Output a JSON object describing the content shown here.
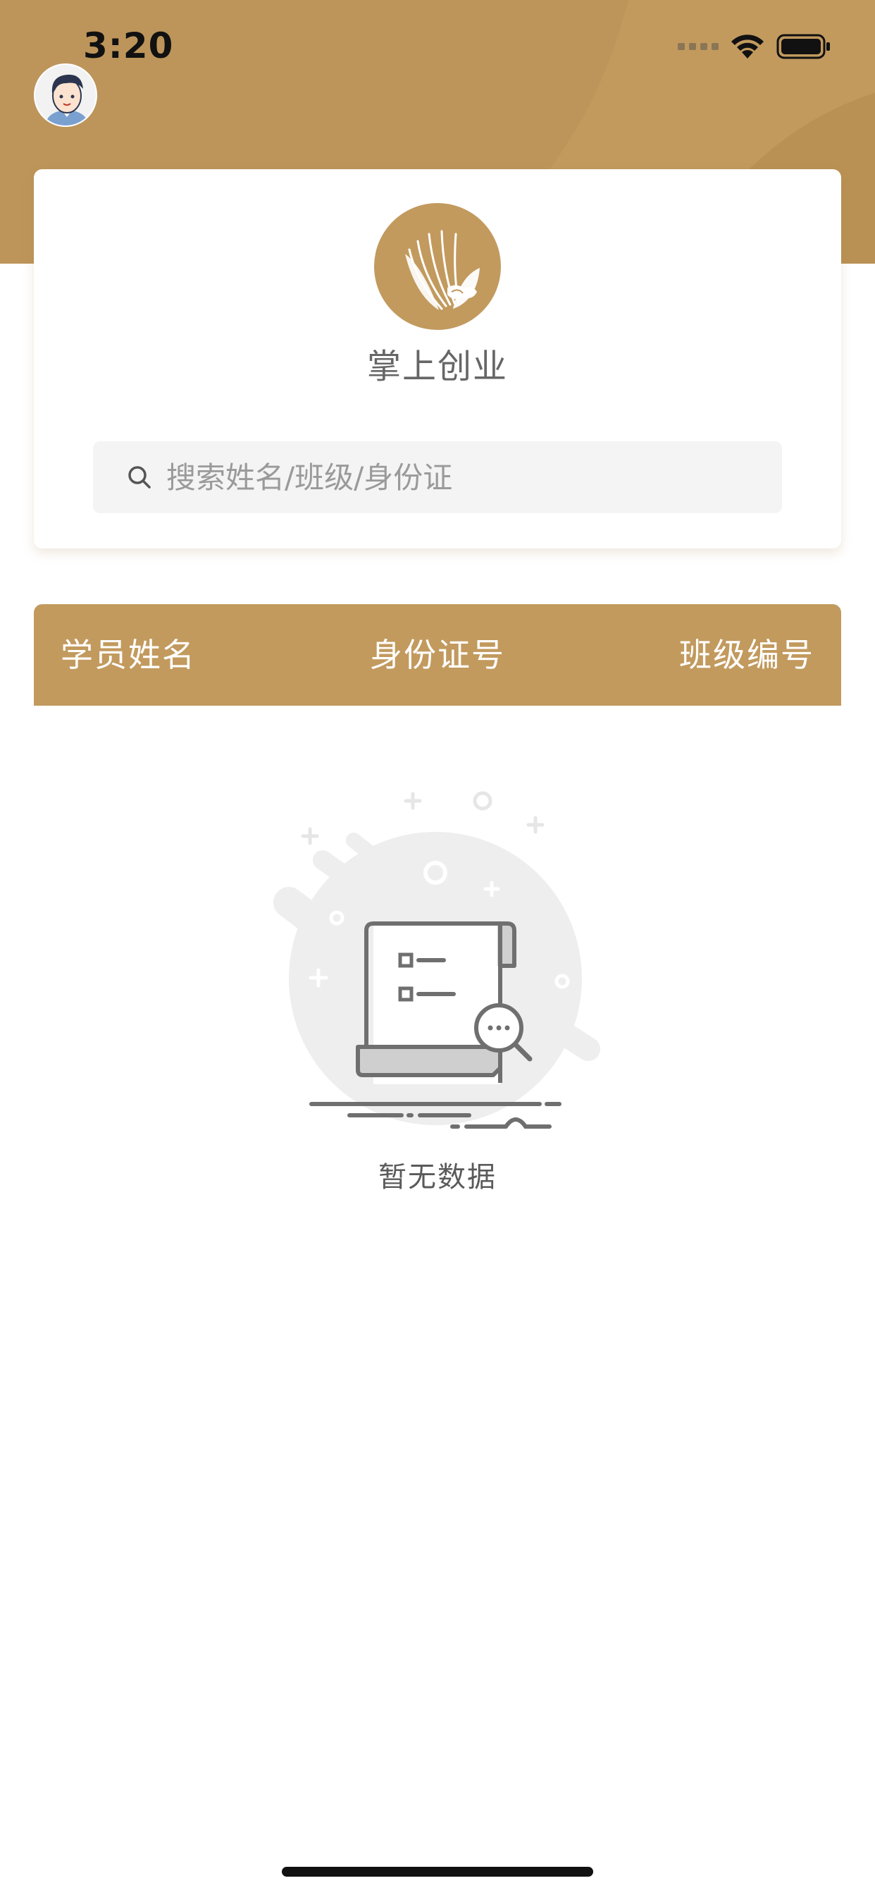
{
  "status_bar": {
    "time": "3:20"
  },
  "brand": {
    "name": "掌上创业"
  },
  "search": {
    "placeholder": "搜索姓名/班级/身份证"
  },
  "table": {
    "columns": [
      "学员姓名",
      "身份证号",
      "班级编号"
    ]
  },
  "empty_state": {
    "message": "暂无数据"
  },
  "colors": {
    "accent": "#c29a5e",
    "accent_dark": "#b78d52",
    "search_bg": "#f4f4f4",
    "muted_text": "#666666"
  },
  "icons": [
    "wifi-icon",
    "battery-icon",
    "avatar",
    "lotus-logo-icon",
    "search-icon",
    "empty-document-search-icon"
  ]
}
